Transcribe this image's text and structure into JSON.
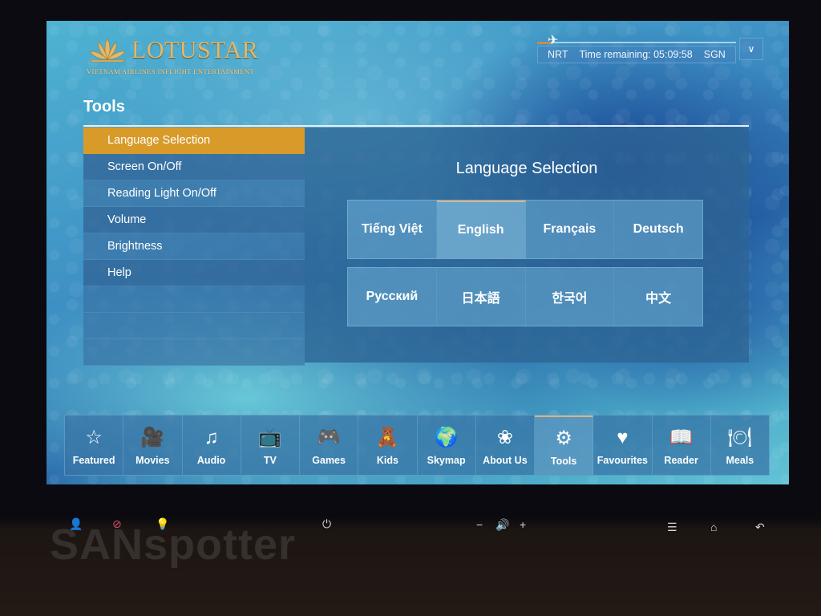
{
  "brand": {
    "name": "LOTUSTAR",
    "tagline": "VIETNAM AIRLINES INFLIGHT ENTERTAINMENT",
    "accent_color": "#e2b86a"
  },
  "flight": {
    "origin": "NRT",
    "time_remaining_label": "Time remaining: 05:09:58",
    "destination": "SGN",
    "progress": 0.03,
    "toggle_icon": "chevron-down-icon"
  },
  "page": {
    "title": "Tools"
  },
  "tools_menu": {
    "items": [
      {
        "label": "Language Selection",
        "active": true
      },
      {
        "label": "Screen On/Off"
      },
      {
        "label": "Reading Light On/Off"
      },
      {
        "label": "Volume"
      },
      {
        "label": "Brightness"
      },
      {
        "label": "Help"
      }
    ],
    "active_color": "#d89b2a"
  },
  "language_panel": {
    "title": "Language Selection",
    "languages": [
      {
        "label": "Tiếng Việt"
      },
      {
        "label": "English",
        "selected": true
      },
      {
        "label": "Français"
      },
      {
        "label": "Deutsch"
      },
      {
        "label": "Русский"
      },
      {
        "label": "日本語"
      },
      {
        "label": "한국어"
      },
      {
        "label": "中文"
      }
    ]
  },
  "nav": {
    "items": [
      {
        "label": "Featured",
        "icon": "star-icon",
        "glyph": "☆"
      },
      {
        "label": "Movies",
        "icon": "movie-camera-icon",
        "glyph": "🎥"
      },
      {
        "label": "Audio",
        "icon": "music-note-icon",
        "glyph": "♫"
      },
      {
        "label": "TV",
        "icon": "tv-icon",
        "glyph": "📺"
      },
      {
        "label": "Games",
        "icon": "gamepad-icon",
        "glyph": "🎮"
      },
      {
        "label": "Kids",
        "icon": "teddy-bear-icon",
        "glyph": "🧸"
      },
      {
        "label": "Skymap",
        "icon": "globe-icon",
        "glyph": "🌍"
      },
      {
        "label": "About Us",
        "icon": "lotus-icon",
        "glyph": "❀"
      },
      {
        "label": "Tools",
        "icon": "gear-icon",
        "glyph": "⚙",
        "active": true
      },
      {
        "label": "Favourites",
        "icon": "heart-icon",
        "glyph": "♥"
      },
      {
        "label": "Reader",
        "icon": "book-icon",
        "glyph": "📖"
      },
      {
        "label": "Meals",
        "icon": "plate-cutlery-icon",
        "glyph": "🍽"
      }
    ]
  },
  "hardware_buttons": {
    "attendant_call": "👤",
    "attendant_cancel": "⊘",
    "reading_light": "💡",
    "power": "⏻",
    "volume_down": "−",
    "volume": "🔊",
    "volume_up": "+",
    "menu": "☰",
    "home": "⌂",
    "back": "↶"
  },
  "watermark": "SANspotter"
}
